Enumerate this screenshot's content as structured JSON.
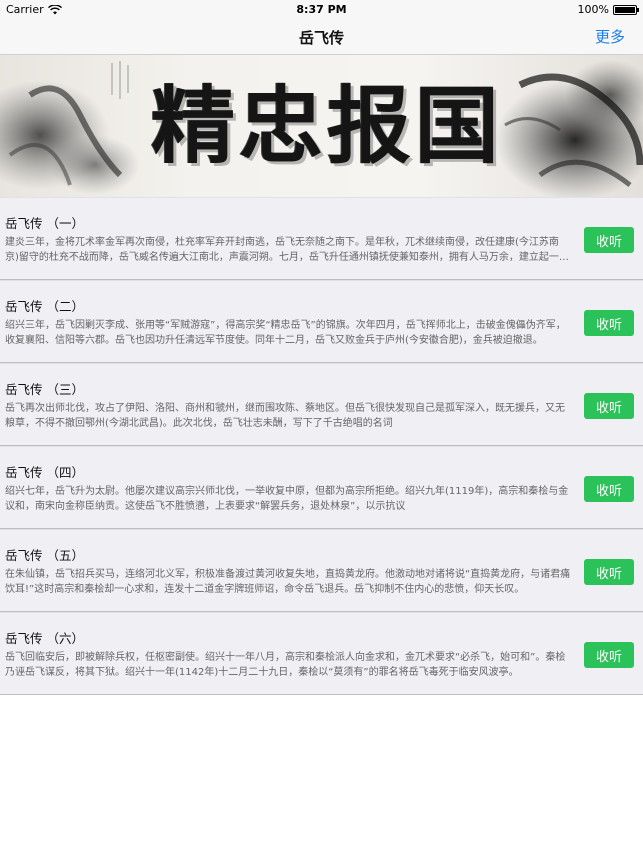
{
  "status_bar": {
    "carrier": "Carrier",
    "time": "8:37 PM",
    "battery": "100%"
  },
  "nav": {
    "title": "岳飞传",
    "more_label": "更多"
  },
  "banner": {
    "title": "精忠报国"
  },
  "items": [
    {
      "title": "岳飞传 （一）",
      "desc": "建炎三年，金将兀术率金军再次南侵，杜充率军弃开封南逃，岳飞无奈随之南下。是年秋，兀术继续南侵，改任建康(今江苏南京)留守的杜充不战而降，岳飞威名传遍大江南北，声震河朔。七月，岳飞升任通州镇抚使兼知泰州，拥有人马万余，建立起一支纪律严明、作战骁勇的抗金劲旅“岳家军”。",
      "button": "收听"
    },
    {
      "title": "岳飞传 （二）",
      "desc": "绍兴三年，岳飞因剿灭李成、张用等“军贼游寇”，得高宗奖“精忠岳飞”的锦旗。次年四月，岳飞挥师北上，击破金傀儡伪齐军，收复襄阳、信阳等六郡。岳飞也因功升任清远军节度使。同年十二月，岳飞又败金兵于庐州(今安徽合肥)，金兵被迫撤退。",
      "button": "收听"
    },
    {
      "title": "岳飞传 （三）",
      "desc": "岳飞再次出师北伐，攻占了伊阳、洛阳、商州和虢州，继而围攻陈、蔡地区。但岳飞很快发现自己是孤军深入，既无援兵，又无粮草，不得不撤回鄂州(今湖北武昌)。此次北伐，岳飞壮志未酬，写下了千古绝唱的名词",
      "button": "收听"
    },
    {
      "title": "岳飞传 （四）",
      "desc": "绍兴七年，岳飞升为太尉。他屡次建议高宗兴师北伐，一举收复中原，但都为高宗所拒绝。绍兴九年(1119年)，高宗和秦桧与金议和，南宋向金称臣纳贡。这使岳飞不胜愤懑，上表要求“解罢兵务，退处林泉”，以示抗议",
      "button": "收听"
    },
    {
      "title": "岳飞传 （五）",
      "desc": "在朱仙镇，岳飞招兵买马，连络河北义军，积极准备渡过黄河收复失地，直捣黄龙府。他激动地对诸将说“直捣黄龙府，与诸君痛饮耳!”这时高宗和秦桧却一心求和，连发十二道金字牌班师诏，命令岳飞退兵。岳飞抑制不住内心的悲愤，仰天长叹。",
      "button": "收听"
    },
    {
      "title": "岳飞传 （六）",
      "desc": "岳飞回临安后，即被解除兵权，任枢密副使。绍兴十一年八月，高宗和秦桧派人向金求和，金兀术要求“必杀飞，始可和”。秦桧乃诬岳飞谋反，将其下狱。绍兴十一年(1142年)十二月二十九日，秦桧以“莫须有”的罪名将岳飞毒死于临安风波亭。",
      "button": "收听"
    }
  ]
}
